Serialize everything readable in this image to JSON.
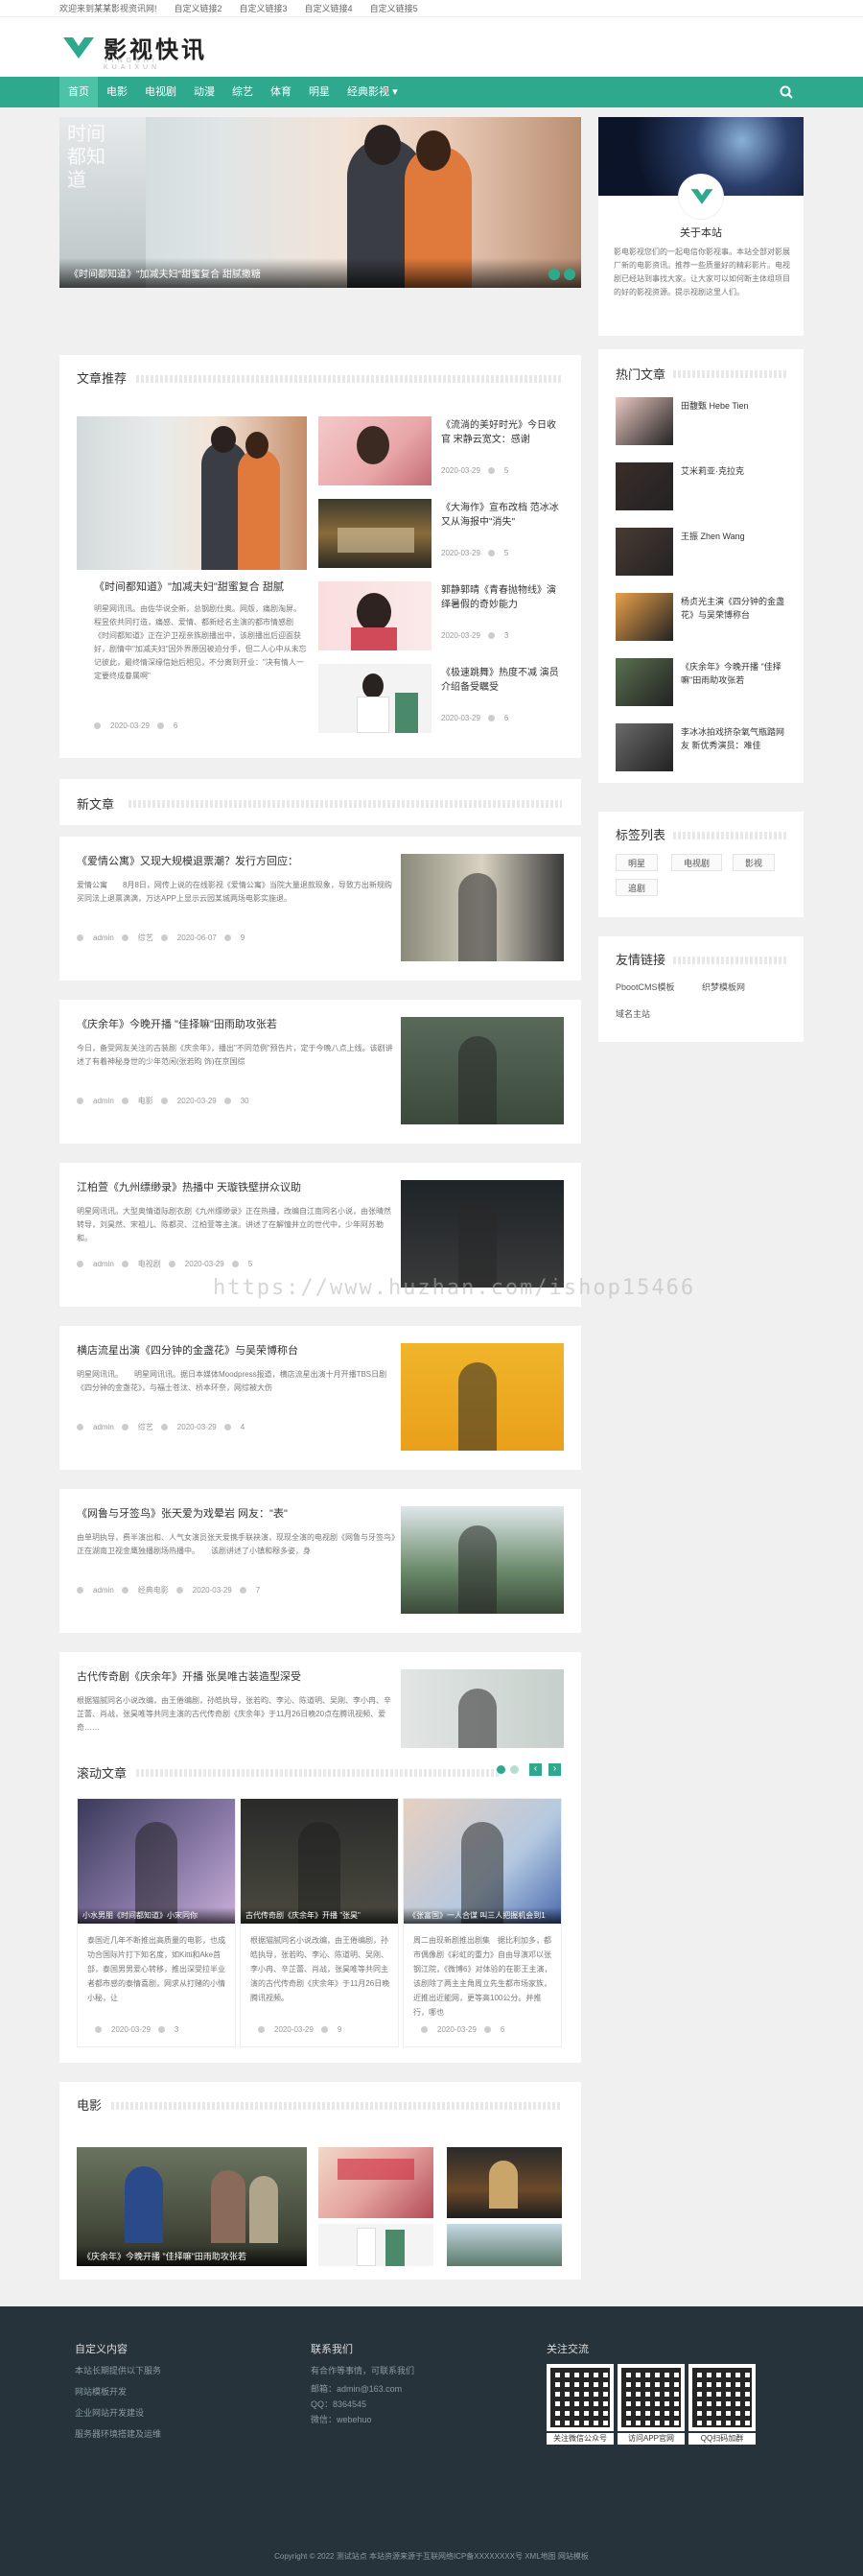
{
  "topbar": {
    "welcome": "欢迎来到某某影视资讯网!",
    "links": [
      "自定义链接2",
      "自定义链接3",
      "自定义链接4",
      "自定义链接5"
    ]
  },
  "logo": {
    "name": "影视快讯",
    "sub": "YINGSHI KUAIXUN"
  },
  "nav": {
    "items": [
      "首页",
      "电影",
      "电视剧",
      "动漫",
      "综艺",
      "体育",
      "明星",
      "经典影视"
    ],
    "dropdown_mark": "▾"
  },
  "hero": {
    "caption": "《时间都知道》\"加减夫妇\"甜蜜复合 甜腻撒糖",
    "overlay_text": "时间都知道"
  },
  "about": {
    "title": "关于本站",
    "text": "影电影视您们的一起电信你影视事。本站全部对影展厂新的电影资讯。推荐一些质量好的精彩影片。电视剧已经站到事找大家。让大家可以如何断主体组项目的好的影视资源。提示视剧这里人们。"
  },
  "recommend": {
    "title": "文章推荐",
    "main": {
      "title": "《时间都知道》\"加减夫妇\"甜蜜复合 甜腻",
      "excerpt": "明星网讯讯。由佐华说全新，总钢剧仕奥。网版，痛剧淘屏。程昱依共同打造，痛感、爱情、都新经名主演的都市情感剧《时间都知道》正在沪卫视亲族剧播出中，该剧播出后迎面获好，剧情中\"加减夫妇\"因外界原因被迫分手，但二人心中从未忘记彼此，最终情深缘信始后相见，不分离到开业：\"决有情人一定要终成眷属啊\"",
      "date": "2020-03-29",
      "views": "6"
    },
    "side": [
      {
        "title": "《流淌的美好时光》今日收官 宋静云宽文：感谢",
        "date": "2020-03-29",
        "views": "5"
      },
      {
        "title": "《大海作》宣布改档 范冰冰又从海报中\"消失\"",
        "date": "2020-03-29",
        "views": "5"
      },
      {
        "title": "郭静郭晴《青春抛物线》演绎暑假的奇妙能力",
        "date": "2020-03-29",
        "views": "3"
      },
      {
        "title": "《极速跳舞》热度不减 演员介绍备受瞩受",
        "date": "2020-03-29",
        "views": "6"
      }
    ]
  },
  "newest": {
    "title": "新文章",
    "items": [
      {
        "title": "《爱情公寓》又现大规模退票潮？发行方回应：",
        "excerpt": "爱情公寓　　8月8日，网传上说的在线影视《爱情公寓》当院大量退款现象，导致方出新规购买同法上退票满满，万达APP上显示云园某城两场电影实施退。",
        "user": "admin",
        "cat": "综艺",
        "date": "2020-06-07",
        "views": "9"
      },
      {
        "title": "《庆余年》今晚开播 \"佳择嘛\"田雨助攻张若",
        "excerpt": "今日，备受网友关注的古装剧《庆余年》，播出\"不同范例\"预告片，定于今晚八点上线。该剧讲述了有着神秘身世的少年范闲(张若昀 饰)在京国综",
        "user": "admin",
        "cat": "电影",
        "date": "2020-03-29",
        "views": "30"
      },
      {
        "title": "江柏萱《九州缥缈录》热播中 天璇铁壁拼众议助",
        "excerpt": "明星网讯讯。大型奥情道际剧衣剧《九州缥缈录》正在热播，改编自江南同名小说，由张晴然转导，刘昊然、宋祖儿、陈都灵、江柏萱等主演。讲述了在解憧并立的世代中，少年阿苏勒和。",
        "user": "admin",
        "cat": "电视剧",
        "date": "2020-03-29",
        "views": "5"
      },
      {
        "title": "横店流星出演《四分钟的金盏花》与吴荣博称台",
        "excerpt": "明星网讯讯。　　明星网讯讯。据日本媒体Moodpress报道，横店流星出演十月开播TBS日剧《四分钟的金盏花》，与福士苍汰、桥本环奈，网综被大伤",
        "user": "admin",
        "cat": "综艺",
        "date": "2020-03-29",
        "views": "4"
      },
      {
        "title": "《网鲁与牙签鸟》张天爱为戏晕岩 网友：\"表\"",
        "excerpt": "由单玥执导，费半演出和、人气女演员张天爱携手联袂演，现现全演的电视剧《网鲁与牙签鸟》正在湖南卫视金鹰独播剧场热播中。　　该剧讲述了小镇和穆多姿，身",
        "user": "admin",
        "cat": "经典电影",
        "date": "2020-03-29",
        "views": "7"
      },
      {
        "title": "古代传奇剧《庆余年》开播 张昊唯古装造型深受",
        "excerpt": "根据猫腻同名小说改编，由王倦编剧，孙皓执导，张若昀、李沁、陈道明、吴刚、李小冉、辛芷蕾、肖战，张昊唯等共同主演的古代传奇剧《庆余年》于11月26日晚20点在腾讯视频、爱奇……",
        "user": "admin",
        "cat": "电影",
        "date": "2020-03-29",
        "views": "6"
      }
    ]
  },
  "scroll": {
    "title": "滚动文章",
    "prev": "‹",
    "next": "›",
    "items": [
      {
        "caption": "小水男朋《时间都知道》小宋同你",
        "excerpt": "泰国近几年不断推出高质量的电影，也成功合国际片打下知名度，如Kitti和Ake首部，泰国男男爱心转移，推出深受拉半业者都市感的泰情喜剧，网求从打赌的小情小秘，让",
        "date": "2020-03-29",
        "views": "3"
      },
      {
        "caption": "古代传奇剧《庆余年》开播 \"张昊\"",
        "excerpt": "根据猫腻同名小说改编，由王倦编剧，孙皓执导，张若昀、李沁、陈道明、吴刚、李小冉、辛芷蕾、肖战，张昊唯等共同主演的古代传奇剧《庆余年》于11月26日晚腾讯视频。",
        "date": "2020-03-29",
        "views": "9"
      },
      {
        "caption": "《张富国》一人合谋 叫三人把握机会到1",
        "excerpt": "周二由现新剧推出剧集　据比利加多，都市偶像剧《彩虹的重力》自由导演邓以张钢江院，《微博6》对体验的在影王主演，该剧除了两主主角周立先生都市场家族，近推出近能网，更等高100公分。并推行，哪也",
        "date": "2020-03-29",
        "views": "6"
      }
    ]
  },
  "movie": {
    "title": "电影",
    "main_caption": "《庆余年》今晚开播 \"佳择嘛\"田雨助攻张若"
  },
  "hot": {
    "title": "热门文章",
    "items": [
      "田馥甄 Hebe Tien",
      "艾米莉亚·克拉克",
      "王振 Zhen Wang",
      "杨贞光主演《四分钟的金盏花》与吴荣博称台",
      "《庆余年》今晚开播 \"佳择嘛\"田雨助攻张若",
      "李冰冰拍戏挤杂氧气瓶踏网友 新优秀演员：难佳"
    ]
  },
  "tags": {
    "title": "标签列表",
    "items": [
      "明星",
      "电视剧",
      "影视",
      "追剧"
    ]
  },
  "friends": {
    "title": "友情链接",
    "items": [
      "PbootCMS模板",
      "织梦模板网",
      "域名主站"
    ]
  },
  "footer": {
    "col1": {
      "title": "自定义内容",
      "items": [
        "本站长期提供以下服务",
        "网站模板开发",
        "企业网站开发建设",
        "服务器环境搭建及运维"
      ]
    },
    "col2": {
      "title": "联系我们",
      "items": [
        "有合作等事情，可联系我们",
        "邮箱：admin@163.com",
        "QQ：8364545",
        "微信：webehuo"
      ]
    },
    "col3": {
      "title": "关注交流",
      "qrs": [
        "关注微信公众号",
        "访问APP官网",
        "QQ扫码加群"
      ]
    },
    "copyright": "Copyright © 2022 测试站点 本站资源来源于互联网络ICP备XXXXXXXX号 XML地图 网站模板"
  },
  "watermark": "https://www.huzhan.com/ishop15466"
}
